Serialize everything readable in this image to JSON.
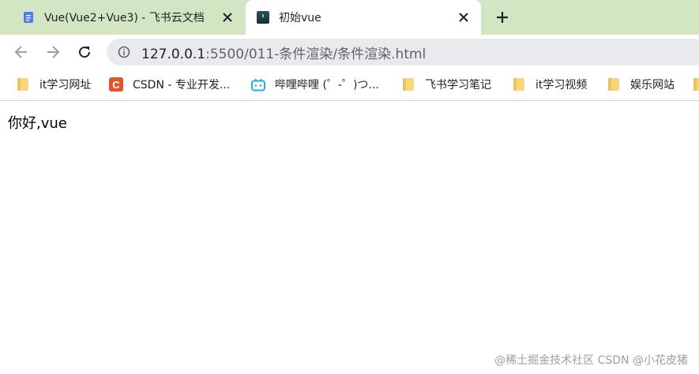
{
  "tabs": [
    {
      "title": "Vue(Vue2+Vue3) - 飞书云文档",
      "icon": "document-icon",
      "active": false
    },
    {
      "title": "初始vue",
      "icon": "page-favicon",
      "active": true
    }
  ],
  "toolbar": {
    "url_host": "127.0.0.1",
    "url_rest": ":5500/011-条件渲染/条件渲染.html"
  },
  "bookmarks": [
    {
      "label": "it学习网址",
      "icon": "folder-icon"
    },
    {
      "label": "CSDN - 专业开发...",
      "icon": "csdn-icon"
    },
    {
      "label": "哔哩哔哩 (゜-゜)つ...",
      "icon": "bilibili-icon"
    },
    {
      "label": "飞书学习笔记",
      "icon": "folder-icon"
    },
    {
      "label": "it学习视频",
      "icon": "folder-icon"
    },
    {
      "label": "娱乐网站",
      "icon": "folder-icon"
    }
  ],
  "page": {
    "text": "你好,vue"
  },
  "watermark": "@稀土掘金技术社区 CSDN @小花皮猪",
  "colors": {
    "tabstrip": "#d3e6c4",
    "omnibox": "#e8eaed",
    "folder": "#f7d77a",
    "csdn": "#e5532d",
    "bilibili": "#23ade5"
  }
}
